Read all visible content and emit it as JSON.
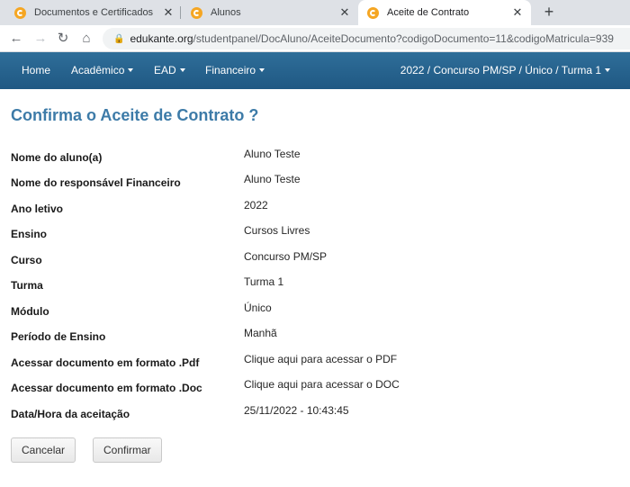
{
  "browser": {
    "tabs": [
      {
        "title": "Documentos e Certificados",
        "close": "✕"
      },
      {
        "title": "Alunos",
        "close": "✕"
      },
      {
        "title": "Aceite de Contrato",
        "close": "✕"
      }
    ],
    "new_tab": "+",
    "url_host": "edukante.org",
    "url_path": "/studentpanel/DocAluno/AceiteDocumento?codigoDocumento=11&codigoMatricula=939",
    "icons": {
      "back": "arrow-left-icon",
      "forward": "arrow-right-icon",
      "reload": "reload-icon",
      "home": "home-icon",
      "lock": "lock-icon",
      "favicon": "edukante-favicon-icon"
    }
  },
  "navbar": {
    "home": "Home",
    "academico": "Acadêmico",
    "ead": "EAD",
    "financeiro": "Financeiro",
    "context": "2022 / Concurso PM/SP / Único / Turma 1"
  },
  "page": {
    "title": "Confirma o Aceite de Contrato ?",
    "fields": [
      {
        "label": "Nome do aluno(a)",
        "value": "Aluno Teste"
      },
      {
        "label": "Nome do responsável Financeiro",
        "value": "Aluno Teste"
      },
      {
        "label": "Ano letivo",
        "value": "2022"
      },
      {
        "label": "Ensino",
        "value": "Cursos Livres"
      },
      {
        "label": "Curso",
        "value": "Concurso PM/SP"
      },
      {
        "label": "Turma",
        "value": "Turma 1"
      },
      {
        "label": "Módulo",
        "value": "Único"
      },
      {
        "label": "Período de Ensino",
        "value": "Manhã"
      },
      {
        "label": "Acessar documento em formato .Pdf",
        "value": "Clique aqui para acessar o PDF"
      },
      {
        "label": "Acessar documento em formato .Doc",
        "value": "Clique aqui para acessar o DOC"
      },
      {
        "label": "Data/Hora da aceitação",
        "value": "25/11/2022 - 10:43:45"
      }
    ],
    "buttons": {
      "cancel": "Cancelar",
      "confirm": "Confirmar"
    }
  },
  "colors": {
    "navbar": "#2a6591",
    "title": "#3d7ba8"
  }
}
